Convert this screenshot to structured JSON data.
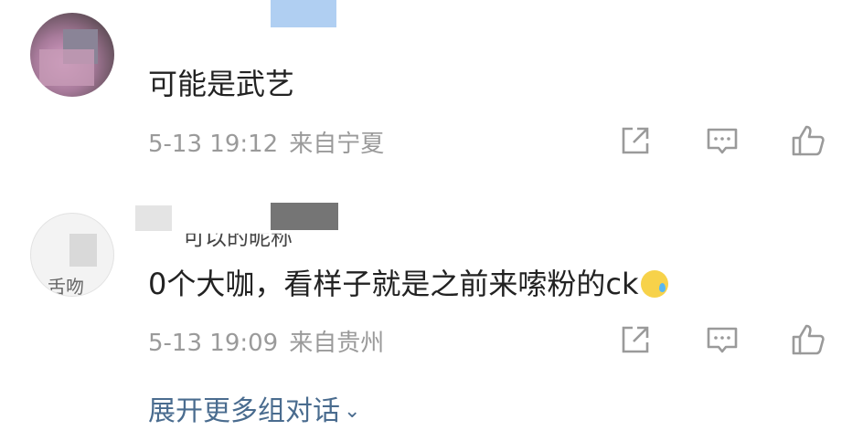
{
  "comments": [
    {
      "text": "可能是武艺",
      "time": "5-13 19:12",
      "location": "来自宁夏"
    },
    {
      "nickname": "可以的昵称",
      "avatar_text": "舌吻",
      "text": "0个大咖，看样子就是之前来嗦粉的ck",
      "emoji": "sweat-emoji",
      "time": "5-13 19:09",
      "location": "来自贵州"
    }
  ],
  "expand_label": "展开更多组对话",
  "colors": {
    "link": "#4a6c8f",
    "meta": "#9a9a9a",
    "text": "#222222"
  }
}
